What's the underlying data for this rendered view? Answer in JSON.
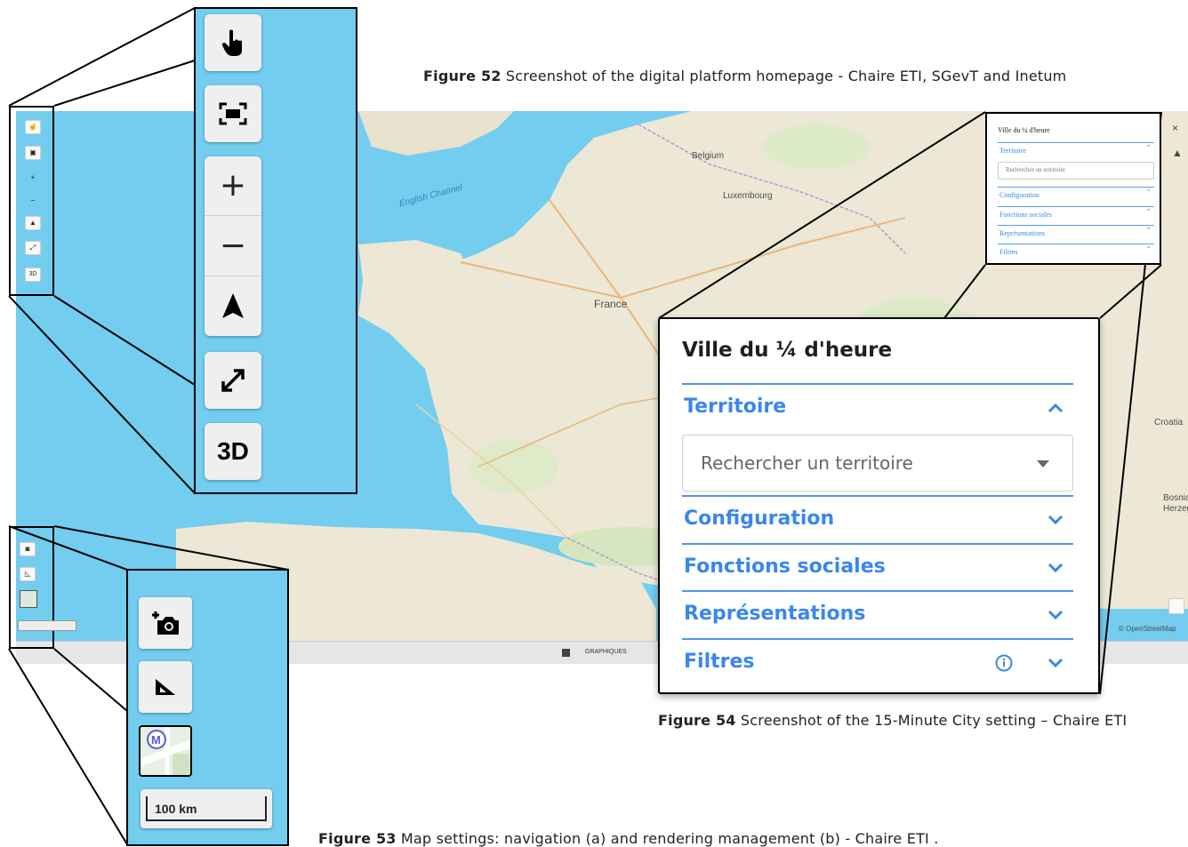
{
  "captions": {
    "fig52_label": "Figure 52",
    "fig52_text": " Screenshot of the digital platform homepage - Chaire ETI, SGevT and Inetum",
    "fig53_label": "Figure 53",
    "fig53_text": " Map settings: navigation (a) and rendering management (b) - Chaire ETI .",
    "fig54_label": "Figure 54",
    "fig54_text": " Screenshot of the 15-Minute City setting – Chaire ETI"
  },
  "map": {
    "labels": {
      "france": "France",
      "belgium": "Belgium",
      "luxembourg": "Luxembourg",
      "english_channel": "English Channel",
      "croatia": "Croatia",
      "bosnia": "Bosnia",
      "herzego": "Herzego",
      "attribution": "© OpenStreetMap",
      "graphiques": "GRAPHIQUES"
    }
  },
  "nav_controls": {
    "zoom_in": "+",
    "zoom_out": "−",
    "threed": "3D"
  },
  "render_controls": {
    "scale": "100 km"
  },
  "panel": {
    "title": "Ville du ¼ d'heure",
    "sections": [
      {
        "label": "Territoire",
        "expanded": true
      },
      {
        "label": "Configuration",
        "expanded": false
      },
      {
        "label": "Fonctions sociales",
        "expanded": false
      },
      {
        "label": "Représentations",
        "expanded": false
      },
      {
        "label": "Filtres",
        "expanded": false
      }
    ],
    "search_placeholder": "Rechercher un territoire"
  },
  "mini_panel": {
    "title": "Ville du ¼ d'heure",
    "territoire": "Territoire",
    "search": "Rechercher un territoire",
    "configuration": "Configuration",
    "fonctions": "Fonctions sociales",
    "representations": "Représentations",
    "filtres": "Filtres"
  },
  "colors": {
    "sea": "#72cdef",
    "land": "#ede7d6",
    "accent": "#3a87ea"
  }
}
